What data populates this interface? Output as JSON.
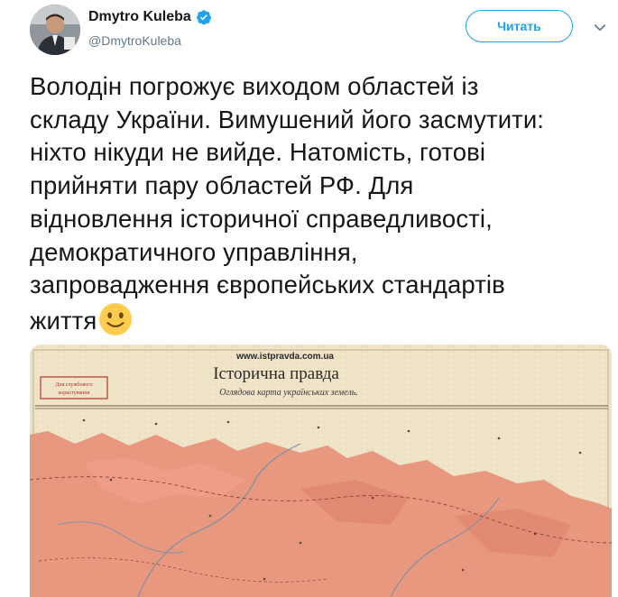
{
  "tweet": {
    "author": {
      "display_name": "Dmytro Kuleba",
      "handle": "@DmytroKuleba",
      "verified": true,
      "avatar_icon": "profile-photo"
    },
    "follow_label": "Читать",
    "menu_icon": "chevron-down-icon",
    "text_lines": [
      "Володін погрожує виходом областей із",
      "складу України. Вимушений його засмутити:",
      "ніхто нікуди не вийде. Натомість, готові",
      "прийняти пару областей РФ. Для",
      "відновлення історичної справедливості,",
      "демократичного управління,",
      "запровадження європейських стандартів",
      "життя"
    ],
    "emoji": "slightly-smiling-face",
    "media": {
      "url_text": "www.istpravda.com.ua",
      "title": "Історична правда",
      "subtitle": "Оглядова карта українських земель.",
      "stamp_text": "Для службового користування"
    }
  },
  "colors": {
    "accent": "#1da1f2",
    "text": "#14171a",
    "secondary": "#657786",
    "map_paper": "#efe3c8",
    "map_region": "#e8917a"
  }
}
